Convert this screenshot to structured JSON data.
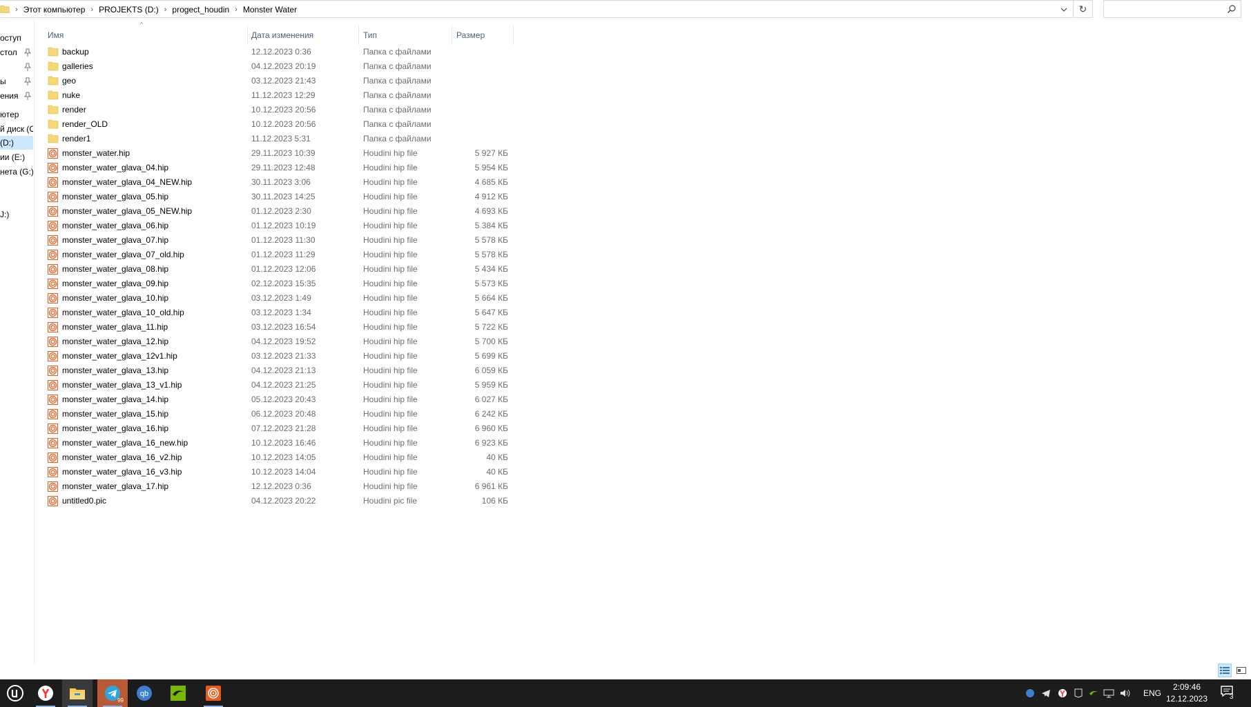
{
  "address": {
    "crumbs": [
      "Этот компьютер",
      "PROJEKTS (D:)",
      "progect_houdin",
      "Monster Water"
    ]
  },
  "search": {
    "placeholder": ""
  },
  "nav": {
    "items": [
      {
        "label": "оступ",
        "pinned": false
      },
      {
        "label": "стол",
        "pinned": true
      },
      {
        "label": "",
        "pinned": true
      },
      {
        "label": "ы",
        "pinned": true
      },
      {
        "label": "ения",
        "pinned": true
      },
      {
        "label": "ютер",
        "pinned": false
      },
      {
        "label": "й диск (C",
        "pinned": false
      },
      {
        "label": "(D:)",
        "pinned": false,
        "selected": true
      },
      {
        "label": "ии (E:)",
        "pinned": false
      },
      {
        "label": "нета (G:)",
        "pinned": false
      },
      {
        "label": "J:)",
        "pinned": false
      }
    ]
  },
  "columns": {
    "name": "Имя",
    "date": "Дата изменения",
    "type": "Тип",
    "size": "Размер"
  },
  "files": [
    {
      "name": "backup",
      "date": "12.12.2023 0:36",
      "type": "Папка с файлами",
      "size": "",
      "kind": "folder"
    },
    {
      "name": "galleries",
      "date": "04.12.2023 20:19",
      "type": "Папка с файлами",
      "size": "",
      "kind": "folder"
    },
    {
      "name": "geo",
      "date": "03.12.2023 21:43",
      "type": "Папка с файлами",
      "size": "",
      "kind": "folder"
    },
    {
      "name": "nuke",
      "date": "11.12.2023 12:29",
      "type": "Папка с файлами",
      "size": "",
      "kind": "folder"
    },
    {
      "name": "render",
      "date": "10.12.2023 20:56",
      "type": "Папка с файлами",
      "size": "",
      "kind": "folder"
    },
    {
      "name": "render_OLD",
      "date": "10.12.2023 20:56",
      "type": "Папка с файлами",
      "size": "",
      "kind": "folder"
    },
    {
      "name": "render1",
      "date": "11.12.2023 5:31",
      "type": "Папка с файлами",
      "size": "",
      "kind": "folder"
    },
    {
      "name": "monster_water.hip",
      "date": "29.11.2023 10:39",
      "type": "Houdini hip file",
      "size": "5 927 КБ",
      "kind": "hip"
    },
    {
      "name": "monster_water_glava_04.hip",
      "date": "29.11.2023 12:48",
      "type": "Houdini hip file",
      "size": "5 954 КБ",
      "kind": "hip"
    },
    {
      "name": "monster_water_glava_04_NEW.hip",
      "date": "30.11.2023 3:06",
      "type": "Houdini hip file",
      "size": "4 685 КБ",
      "kind": "hip"
    },
    {
      "name": "monster_water_glava_05.hip",
      "date": "30.11.2023 14:25",
      "type": "Houdini hip file",
      "size": "4 912 КБ",
      "kind": "hip"
    },
    {
      "name": "monster_water_glava_05_NEW.hip",
      "date": "01.12.2023 2:30",
      "type": "Houdini hip file",
      "size": "4 693 КБ",
      "kind": "hip"
    },
    {
      "name": "monster_water_glava_06.hip",
      "date": "01.12.2023 10:19",
      "type": "Houdini hip file",
      "size": "5 384 КБ",
      "kind": "hip"
    },
    {
      "name": "monster_water_glava_07.hip",
      "date": "01.12.2023 11:30",
      "type": "Houdini hip file",
      "size": "5 578 КБ",
      "kind": "hip"
    },
    {
      "name": "monster_water_glava_07_old.hip",
      "date": "01.12.2023 11:29",
      "type": "Houdini hip file",
      "size": "5 578 КБ",
      "kind": "hip"
    },
    {
      "name": "monster_water_glava_08.hip",
      "date": "01.12.2023 12:06",
      "type": "Houdini hip file",
      "size": "5 434 КБ",
      "kind": "hip"
    },
    {
      "name": "monster_water_glava_09.hip",
      "date": "02.12.2023 15:35",
      "type": "Houdini hip file",
      "size": "5 573 КБ",
      "kind": "hip"
    },
    {
      "name": "monster_water_glava_10.hip",
      "date": "03.12.2023 1:49",
      "type": "Houdini hip file",
      "size": "5 664 КБ",
      "kind": "hip"
    },
    {
      "name": "monster_water_glava_10_old.hip",
      "date": "03.12.2023 1:34",
      "type": "Houdini hip file",
      "size": "5 647 КБ",
      "kind": "hip"
    },
    {
      "name": "monster_water_glava_11.hip",
      "date": "03.12.2023 16:54",
      "type": "Houdini hip file",
      "size": "5 722 КБ",
      "kind": "hip"
    },
    {
      "name": "monster_water_glava_12.hip",
      "date": "04.12.2023 19:52",
      "type": "Houdini hip file",
      "size": "5 700 КБ",
      "kind": "hip"
    },
    {
      "name": "monster_water_glava_12v1.hip",
      "date": "03.12.2023 21:33",
      "type": "Houdini hip file",
      "size": "5 699 КБ",
      "kind": "hip"
    },
    {
      "name": "monster_water_glava_13.hip",
      "date": "04.12.2023 21:13",
      "type": "Houdini hip file",
      "size": "6 059 КБ",
      "kind": "hip"
    },
    {
      "name": "monster_water_glava_13_v1.hip",
      "date": "04.12.2023 21:25",
      "type": "Houdini hip file",
      "size": "5 959 КБ",
      "kind": "hip"
    },
    {
      "name": "monster_water_glava_14.hip",
      "date": "05.12.2023 20:43",
      "type": "Houdini hip file",
      "size": "6 027 КБ",
      "kind": "hip"
    },
    {
      "name": "monster_water_glava_15.hip",
      "date": "06.12.2023 20:48",
      "type": "Houdini hip file",
      "size": "6 242 КБ",
      "kind": "hip"
    },
    {
      "name": "monster_water_glava_16.hip",
      "date": "07.12.2023 21:28",
      "type": "Houdini hip file",
      "size": "6 960 КБ",
      "kind": "hip"
    },
    {
      "name": "monster_water_glava_16_new.hip",
      "date": "10.12.2023 16:46",
      "type": "Houdini hip file",
      "size": "6 923 КБ",
      "kind": "hip"
    },
    {
      "name": "monster_water_glava_16_v2.hip",
      "date": "10.12.2023 14:05",
      "type": "Houdini hip file",
      "size": "40 КБ",
      "kind": "hip"
    },
    {
      "name": "monster_water_glava_16_v3.hip",
      "date": "10.12.2023 14:04",
      "type": "Houdini hip file",
      "size": "40 КБ",
      "kind": "hip"
    },
    {
      "name": "monster_water_glava_17.hip",
      "date": "12.12.2023 0:36",
      "type": "Houdini hip file",
      "size": "6 961 КБ",
      "kind": "hip"
    },
    {
      "name": "untitled0.pic",
      "date": "04.12.2023 20:22",
      "type": "Houdini pic file",
      "size": "106 КБ",
      "kind": "hip"
    }
  ],
  "taskbar": {
    "apps": [
      {
        "name": "unreal-engine-icon",
        "running": false
      },
      {
        "name": "yandex-browser-icon",
        "running": true
      },
      {
        "name": "file-explorer-icon",
        "running": true,
        "active": true
      },
      {
        "name": "telegram-icon",
        "running": true,
        "badge": "99"
      },
      {
        "name": "qbittorrent-icon",
        "running": false
      },
      {
        "name": "nvidia-icon",
        "running": false
      },
      {
        "name": "houdini-icon",
        "running": true
      }
    ],
    "tray": {
      "language": "ENG",
      "time": "2:09:46",
      "date": "12.12.2023",
      "notifications": "3"
    }
  },
  "colors": {
    "accent": "#0078d7",
    "folder": "#f8d775",
    "houdini": "#e65c1c",
    "taskbar": "#1c1c1c"
  }
}
